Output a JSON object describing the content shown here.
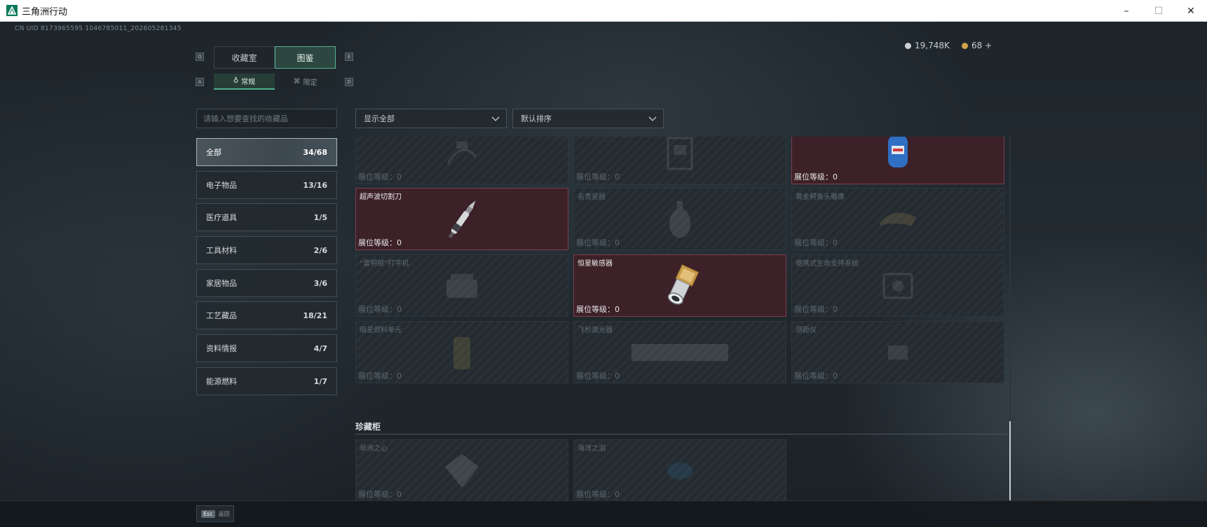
{
  "window": {
    "title": "三角洲行动",
    "controls": {
      "minimize": "–",
      "maximize": "☐",
      "close": "✕"
    }
  },
  "header": {
    "uid": "CN UID 8173965595 1046785011_202605281345",
    "currency": [
      {
        "value": "19,748K",
        "color": "#c9cfd2"
      },
      {
        "value": "68 +",
        "color": "#d2a24a"
      }
    ]
  },
  "tabs": {
    "hint_left": "Q",
    "hint_right": "E",
    "items": [
      {
        "label": "收藏室"
      },
      {
        "label": "图鉴",
        "active": true
      }
    ]
  },
  "subtabs": {
    "hint_left": "A",
    "hint_right": "D",
    "items": [
      {
        "label": "常规",
        "active": true
      },
      {
        "label": "限定"
      }
    ]
  },
  "search": {
    "placeholder": "请输入想要查找的收藏品"
  },
  "categories": [
    {
      "label": "全部",
      "count": "34/68",
      "active": true
    },
    {
      "label": "电子物品",
      "count": "13/16"
    },
    {
      "label": "医疗道具",
      "count": "1/5"
    },
    {
      "label": "工具材料",
      "count": "2/6"
    },
    {
      "label": "家居物品",
      "count": "3/6"
    },
    {
      "label": "工艺藏品",
      "count": "18/21"
    },
    {
      "label": "资料情报",
      "count": "4/7"
    },
    {
      "label": "能源燃料",
      "count": "1/7"
    }
  ],
  "filters": {
    "show": "显示全部",
    "sort": "默认排序"
  },
  "level_label": "展位等级：0",
  "items": [
    {
      "name": "",
      "owned": false,
      "icon": "cable-icon"
    },
    {
      "name": "",
      "owned": false,
      "icon": "device-icon"
    },
    {
      "name": "",
      "owned": true,
      "icon": "gas-canister-icon"
    },
    {
      "name": "超声波切割刀",
      "owned": true,
      "icon": "ultrasonic-knife-icon"
    },
    {
      "name": "名贵瓷器",
      "owned": false,
      "icon": "vase-icon"
    },
    {
      "name": "黄金鳄鱼头雕像",
      "owned": false,
      "icon": "crocodile-statue-icon"
    },
    {
      "name": "“雷明顿”打字机",
      "owned": false,
      "icon": "typewriter-icon"
    },
    {
      "name": "恒星敏感器",
      "owned": true,
      "icon": "star-sensor-icon"
    },
    {
      "name": "便携式生命支持系统",
      "owned": false,
      "icon": "life-support-icon"
    },
    {
      "name": "暗星燃料单元",
      "owned": false,
      "icon": "fuel-cell-icon"
    },
    {
      "name": "飞秒激光器",
      "owned": false,
      "icon": "laser-icon"
    },
    {
      "name": "测距仪",
      "owned": false,
      "icon": "rangefinder-icon"
    }
  ],
  "vault": {
    "title": "珍藏柜",
    "items": [
      {
        "name": "非洲之心",
        "owned": false,
        "icon": "diamond-icon"
      },
      {
        "name": "海洋之泪",
        "owned": false,
        "icon": "gem-icon"
      }
    ]
  },
  "footer": {
    "key": "Esc",
    "label": "返回"
  }
}
